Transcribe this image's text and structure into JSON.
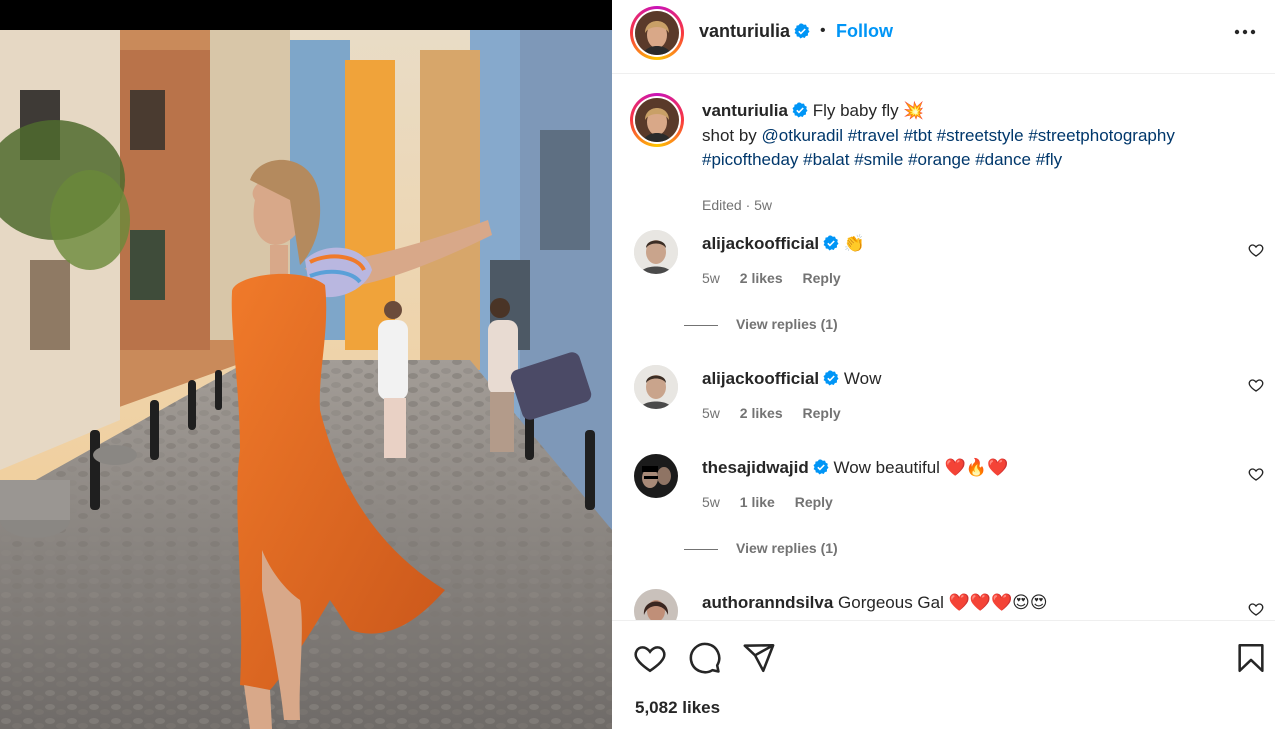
{
  "post": {
    "username": "vanturiulia",
    "follow_label": "Follow",
    "separator": "•"
  },
  "caption": {
    "username": "vanturiulia",
    "text": "Fly baby fly",
    "text_emoji": "💥",
    "shot_by": "shot by",
    "mention": "@otkuradil",
    "hashtags": [
      "#travel",
      "#tbt",
      "#streetstyle",
      "#streetphotography",
      "#picoftheday",
      "#balat",
      "#smile",
      "#orange",
      "#dance",
      "#fly"
    ],
    "meta": "Edited · 5w"
  },
  "comments": [
    {
      "username": "alijackoofficial",
      "text": "",
      "emoji": "👏",
      "age": "5w",
      "likes": "2 likes",
      "reply": "Reply",
      "view_replies": "View replies (1)"
    },
    {
      "username": "alijackoofficial",
      "text": "Wow",
      "emoji": "",
      "age": "5w",
      "likes": "2 likes",
      "reply": "Reply",
      "view_replies": ""
    },
    {
      "username": "thesajidwajid",
      "text": "Wow beautiful",
      "emoji": "❤️🔥❤️",
      "age": "5w",
      "likes": "1 like",
      "reply": "Reply",
      "view_replies": "View replies (1)"
    },
    {
      "username": "authoranndsilva",
      "text": "Gorgeous Gal",
      "emoji": "❤️❤️❤️😍😍",
      "age": "",
      "likes": "",
      "reply": "",
      "view_replies": ""
    }
  ],
  "footer": {
    "likes": "5,082 likes",
    "icons": [
      "heart-icon",
      "comment-icon",
      "share-icon",
      "bookmark-icon"
    ]
  },
  "colors": {
    "link_blue": "#0095f6",
    "hashtag": "#00376b",
    "muted": "#737373",
    "dress": "#e06a1f"
  }
}
